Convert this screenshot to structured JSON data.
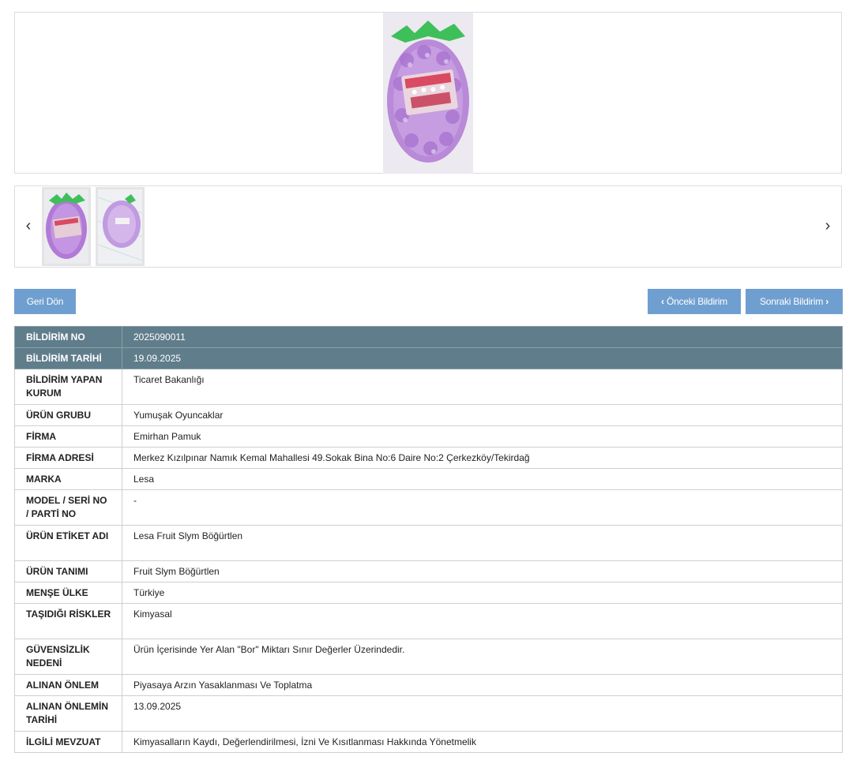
{
  "gallery": {
    "main_image": "purple-blackberry-slime-toy-photo",
    "thumbnails": [
      "purple-blackberry-slime-front",
      "purple-blackberry-slime-back"
    ],
    "prev_arrow": "‹",
    "next_arrow": "›"
  },
  "actions": {
    "back_label": "Geri Dön",
    "prev_label": "Önceki Bildirim",
    "next_label": "Sonraki Bildirim",
    "button_color": "#6f9fd0"
  },
  "details": {
    "header_color": "#607d8b",
    "rows": [
      {
        "label": "BİLDİRİM NO",
        "value": "2025090011"
      },
      {
        "label": "BİLDİRİM TARİHİ",
        "value": "19.09.2025"
      },
      {
        "label": "BİLDİRİM YAPAN KURUM",
        "value": "Ticaret Bakanlığı"
      },
      {
        "label": "ÜRÜN GRUBU",
        "value": "Yumuşak Oyuncaklar"
      },
      {
        "label": "FİRMA",
        "value": "Emirhan Pamuk"
      },
      {
        "label": "FİRMA ADRESİ",
        "value": "Merkez Kızılpınar Namık Kemal Mahallesi 49.Sokak Bina No:6 Daire No:2 Çerkezköy/Tekirdağ"
      },
      {
        "label": "MARKA",
        "value": "Lesa"
      },
      {
        "label": "MODEL / SERİ NO / PARTİ NO",
        "value": "-"
      },
      {
        "label": "ÜRÜN ETİKET ADI",
        "value": "Lesa Fruit Slym Böğürtlen"
      },
      {
        "label": "ÜRÜN TANIMI",
        "value": "Fruit Slym Böğürtlen"
      },
      {
        "label": "MENŞE ÜLKE",
        "value": "Türkiye"
      },
      {
        "label": "TAŞIDIĞI RİSKLER",
        "value": "Kimyasal"
      },
      {
        "label": "GÜVENSİZLİK NEDENİ",
        "value": "Ürün İçerisinde Yer Alan \"Bor\" Miktarı Sınır Değerler Üzerindedir."
      },
      {
        "label": "ALINAN ÖNLEM",
        "value": "Piyasaya Arzın Yasaklanması Ve Toplatma"
      },
      {
        "label": "ALINAN ÖNLEMİN TARİHİ",
        "value": "13.09.2025"
      },
      {
        "label": "İLGİLİ MEVZUAT",
        "value": "Kimyasalların Kaydı, Değerlendirilmesi, İzni Ve Kısıtlanması Hakkında Yönetmelik"
      }
    ]
  }
}
